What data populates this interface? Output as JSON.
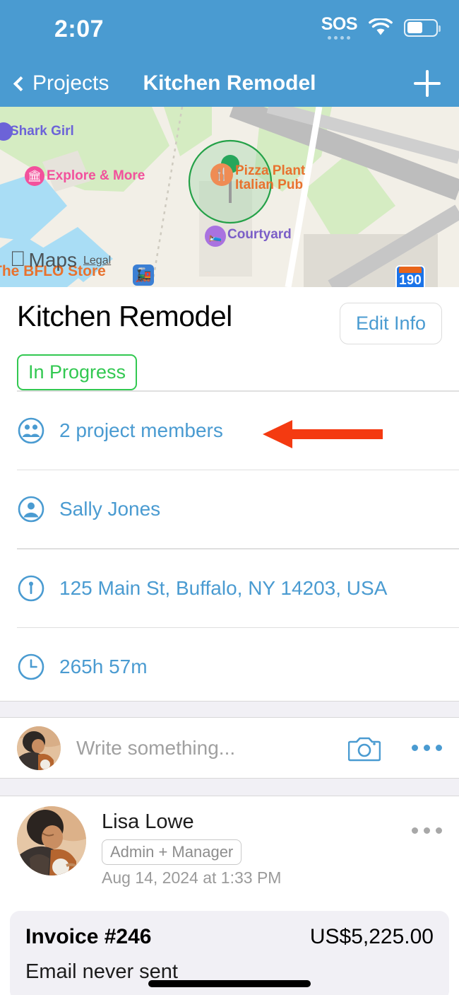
{
  "status_bar": {
    "time": "2:07",
    "sos_label": "SOS",
    "wifi_icon": "wifi-icon",
    "battery_icon": "battery-icon"
  },
  "nav_bar": {
    "back_icon": "chevron-left-icon",
    "back_label": "Projects",
    "title": "Kitchen Remodel",
    "add_icon": "plus-icon"
  },
  "map": {
    "attribution": "Maps",
    "apple_logo": "apple-logo-icon",
    "legal_link": "Legal",
    "highway_shield": "190",
    "transit_icon": "train-icon",
    "labels": [
      {
        "text": "Shark Girl",
        "color": "#6c63d8",
        "poi": "art-icon"
      },
      {
        "text": "Explore & More",
        "color": "#f2519c",
        "poi": "museum-icon"
      },
      {
        "text": "Pizza Plant",
        "color": "#e8722e",
        "poi": "restaurant-icon"
      },
      {
        "text": "Italian Pub",
        "color": "#e8722e",
        "poi": "restaurant-icon"
      },
      {
        "text": "Courtyard",
        "color": "#7b5ec7",
        "poi": "hotel-icon"
      },
      {
        "text": "The BFLO Store",
        "color": "#e8722e",
        "poi": "store-icon"
      }
    ],
    "pin_icon": "map-pin-icon"
  },
  "project": {
    "title": "Kitchen Remodel",
    "edit_button": "Edit Info",
    "status": "In Progress",
    "status_color": "#32c851"
  },
  "info_rows": [
    {
      "icon": "group-icon",
      "label": "2 project members"
    },
    {
      "icon": "person-icon",
      "label": "Sally Jones"
    },
    {
      "icon": "location-pin-icon",
      "label": "125 Main St, Buffalo, NY 14203, USA"
    },
    {
      "icon": "clock-icon",
      "label": "265h 57m"
    }
  ],
  "annotation": {
    "arrow_color": "#f43a11",
    "points_to": "2 project members"
  },
  "composer": {
    "avatar": "user-avatar",
    "placeholder": "Write something...",
    "camera_icon": "camera-icon",
    "more_icon": "ellipsis-icon"
  },
  "post": {
    "avatar": "lisa-lowe-avatar",
    "author": "Lisa Lowe",
    "role": "Admin + Manager",
    "date": "Aug 14, 2024 at 1:33 PM",
    "more_icon": "ellipsis-icon",
    "invoice": {
      "title": "Invoice #246",
      "amount": "US$5,225.00",
      "subtitle": "Email never sent"
    }
  },
  "theme": {
    "accent": "#4a9bd1",
    "nav_background": "#4a9bd1",
    "link_blue": "#4a9bd1",
    "status_green": "#32c851",
    "card_gray": "#f1f0f5"
  }
}
